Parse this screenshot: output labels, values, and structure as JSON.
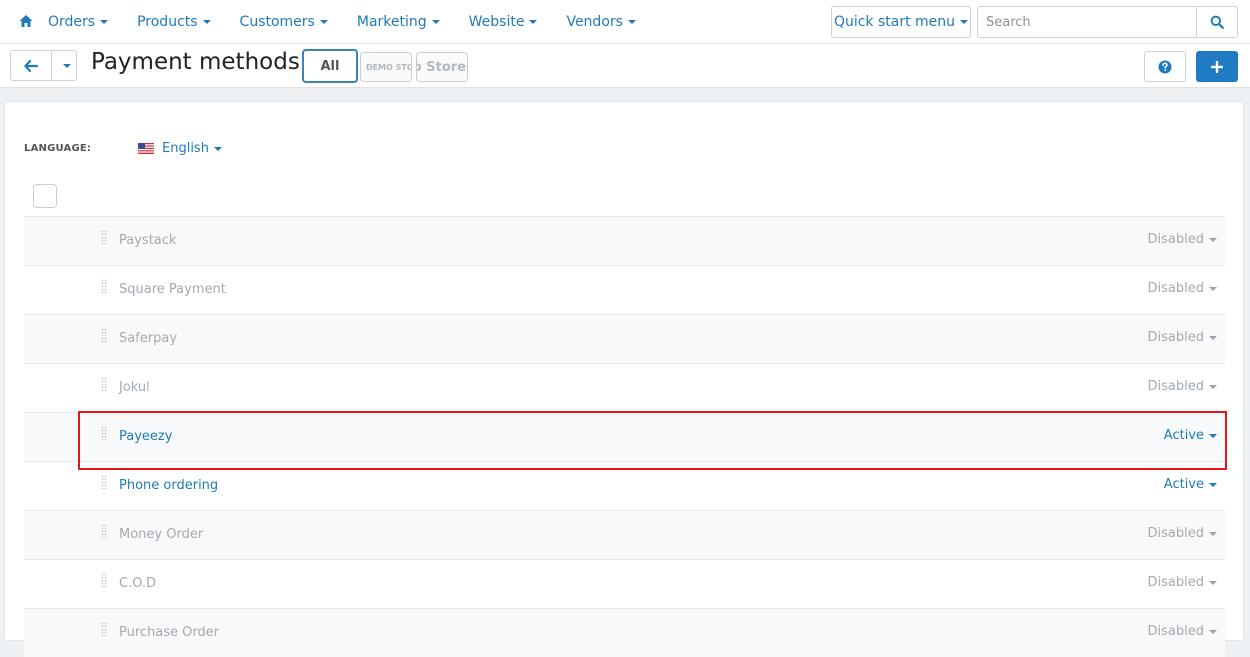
{
  "nav": {
    "items": [
      {
        "label": "Orders"
      },
      {
        "label": "Products"
      },
      {
        "label": "Customers"
      },
      {
        "label": "Marketing"
      },
      {
        "label": "Website"
      },
      {
        "label": "Vendors"
      }
    ],
    "quick_start_label": "Quick start menu",
    "search_placeholder": "Search"
  },
  "header": {
    "title": "Payment methods",
    "store_tabs": {
      "all": "All",
      "logo_one": "DEMO STORE",
      "logo_two": "Demo Store"
    }
  },
  "language": {
    "label": "LANGUAGE:",
    "value": "English"
  },
  "payment_methods": [
    {
      "name": "Paystack",
      "status": "Disabled"
    },
    {
      "name": "Square Payment",
      "status": "Disabled"
    },
    {
      "name": "Saferpay",
      "status": "Disabled"
    },
    {
      "name": "Jokul",
      "status": "Disabled"
    },
    {
      "name": "Payeezy",
      "status": "Active"
    },
    {
      "name": "Phone ordering",
      "status": "Active"
    },
    {
      "name": "Money Order",
      "status": "Disabled"
    },
    {
      "name": "C.O.D",
      "status": "Disabled"
    },
    {
      "name": "Purchase Order",
      "status": "Disabled"
    }
  ],
  "colors": {
    "accent": "#1f7bb8",
    "primary_button": "#1f7bc4",
    "highlight": "#e0161b",
    "disabled_text": "#a3aab0"
  }
}
